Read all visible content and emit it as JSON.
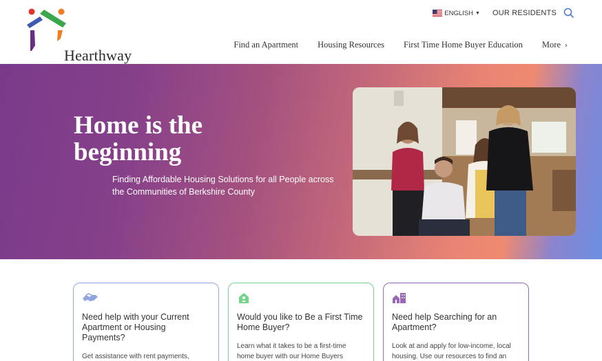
{
  "header": {
    "logo_text": "Hearthway",
    "language": "ENGLISH",
    "residents_link": "OUR RESIDENTS",
    "icons": {
      "flag": "us-flag-icon",
      "search": "search-icon",
      "caret": "caret-down-icon",
      "more": "chevron-right-icon"
    }
  },
  "nav": {
    "items": [
      "Find an Apartment",
      "Housing Resources",
      "First Time Home Buyer Education",
      "More"
    ]
  },
  "hero": {
    "title": "Home is the beginning",
    "subtitle": "Finding Affordable Housing Solutions for all People across the Communities of Berkshire County"
  },
  "cards": [
    {
      "title": "Need help with your Current Apartment or Housing Payments?",
      "text": "Get assistance with rent payments, emergency rent or mortgage assistance,",
      "icon": "handshake-icon",
      "accent": "#8fa6e3"
    },
    {
      "title": "Would you like to Be a First Time Home Buyer?",
      "text": "Learn what it takes to be a first-time home buyer with our Home Buyers",
      "icon": "house-person-icon",
      "accent": "#72d58b"
    },
    {
      "title": "Need help Searching for an Apartment?",
      "text": "Look at and apply for low-income, local housing. Use our resources to find an",
      "icon": "apartment-building-icon",
      "accent": "#9a66b8"
    }
  ],
  "colors": {
    "brand_purple": "#7a3a8a",
    "brand_coral": "#ef8a70",
    "brand_blue": "#6a8fe0"
  }
}
